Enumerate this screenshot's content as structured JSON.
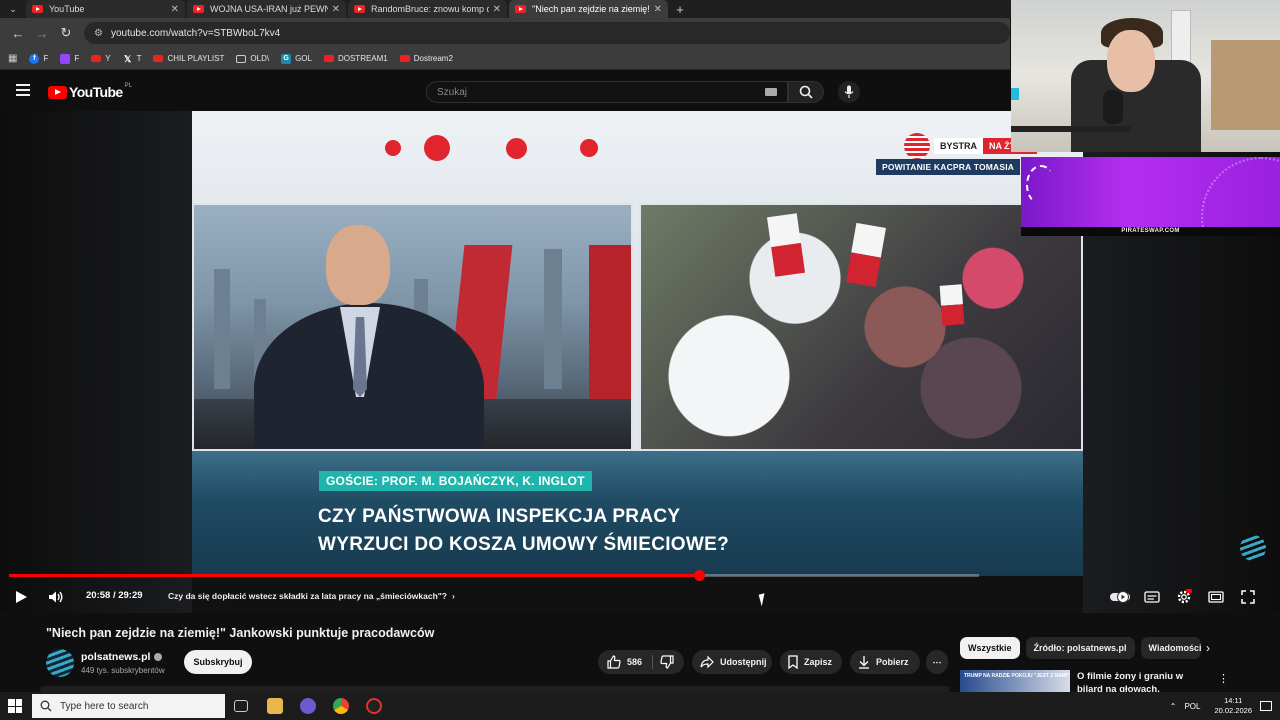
{
  "browser": {
    "tabs": [
      {
        "title": "YouTube",
        "active": false
      },
      {
        "title": "WOJNA USA-IRAN już PEWNA",
        "active": false
      },
      {
        "title": "RandomBruce: znowu komp do",
        "active": false
      },
      {
        "title": "\"Niech pan zejdzie na ziemię!\"",
        "active": true
      }
    ],
    "url": "youtube.com/watch?v=STBWboL7kv4",
    "bookmarks": [
      {
        "label": "F",
        "icon": "facebook-icon"
      },
      {
        "label": "F",
        "icon": "twitch-icon"
      },
      {
        "label": "Y",
        "icon": "youtube-icon"
      },
      {
        "label": "T",
        "icon": "x-icon"
      },
      {
        "label": "CHIL PLAYLIST",
        "icon": "youtube-icon"
      },
      {
        "label": "OLD\\",
        "icon": "folder-icon"
      },
      {
        "label": "GOL",
        "icon": "gol-icon"
      },
      {
        "label": "DOSTREAM1",
        "icon": "youtube-icon"
      },
      {
        "label": "Dostream2",
        "icon": "youtube-icon"
      }
    ]
  },
  "youtube": {
    "logo_text": "YouTube",
    "region": "PL",
    "search_placeholder": "Szukaj"
  },
  "video": {
    "channel_badge_1": "BYSTRA",
    "channel_badge_2": "NA ŻYWO",
    "welcome": "POWITANIE KACPRA TOMASIA",
    "guests": "GOŚCIE: PROF. M. BOJAŃCZYK, K. INGLOT",
    "headline_line1": "CZY PAŃSTWOWA INSPEKCJA PRACY",
    "headline_line2": "WYRZUCI DO KOSZA UMOWY ŚMIECIOWE?",
    "time_current": "20:58",
    "time_total": "29:29",
    "progress_fraction": 0.7113,
    "buffered_fraction": 0.9722,
    "chapter": "Czy da się dopłacić wstecz składki za lata pracy na „śmieciówkach\"?"
  },
  "overlay": {
    "sponsor": "PIRATESWAP.COM"
  },
  "watch": {
    "title": "\"Niech pan zejdzie na ziemię!\" Jankowski punktuje pracodawców",
    "channel": "polsatnews.pl",
    "subscribers": "449 tys. subskrybentów",
    "subscribe_label": "Subskrybuj",
    "likes": "586",
    "share_label": "Udostępnij",
    "save_label": "Zapisz",
    "download_label": "Pobierz",
    "more_label": "⋯"
  },
  "sidebar": {
    "chips": [
      "Wszystkie",
      "Źródło: polsatnews.pl",
      "Wiadomości"
    ],
    "rec_thumb_text": "TRUMP NA RADZIE POKOJU \"JEST Z NAMI\"",
    "rec_title": "O filmie żony i graniu w bilard na głowach. Najdziwniejsze"
  },
  "taskbar": {
    "search_placeholder": "Type here to search",
    "language": "POL",
    "time": "14:11",
    "date": "20.02.2026"
  },
  "colors": {
    "yt_red": "#ff0000",
    "polsat_red": "#e0252f",
    "guest_teal": "#1fb5ad",
    "banner_purple": "#b42ef0"
  }
}
